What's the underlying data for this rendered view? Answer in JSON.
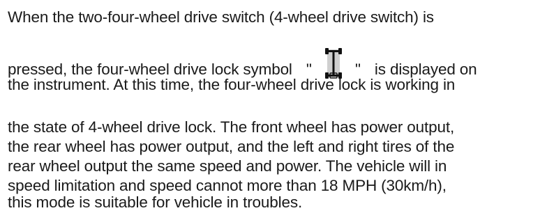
{
  "paragraph": {
    "line1": "When the two-four-wheel drive switch (4-wheel drive switch) is",
    "line2_before": "pressed, the four-wheel drive lock symbol",
    "line2_quote_open": "\"",
    "line2_quote_close": "\"",
    "line2_after": "is displayed on",
    "line3": "the instrument. At this time, the four-wheel drive lock is working in",
    "line4": "the state of 4-wheel drive lock. The front wheel has power output,",
    "line5": "the rear wheel has power output, and the left and right tires of the",
    "line6": "rear wheel output the same speed and power. The vehicle will in",
    "line7": "speed limitation and speed cannot more than 18 MPH (30km/h),",
    "line8": "this mode is suitable for vehicle in troubles."
  },
  "icons": {
    "four_wheel_drive_lock": "4wd-lock-symbol-icon"
  }
}
